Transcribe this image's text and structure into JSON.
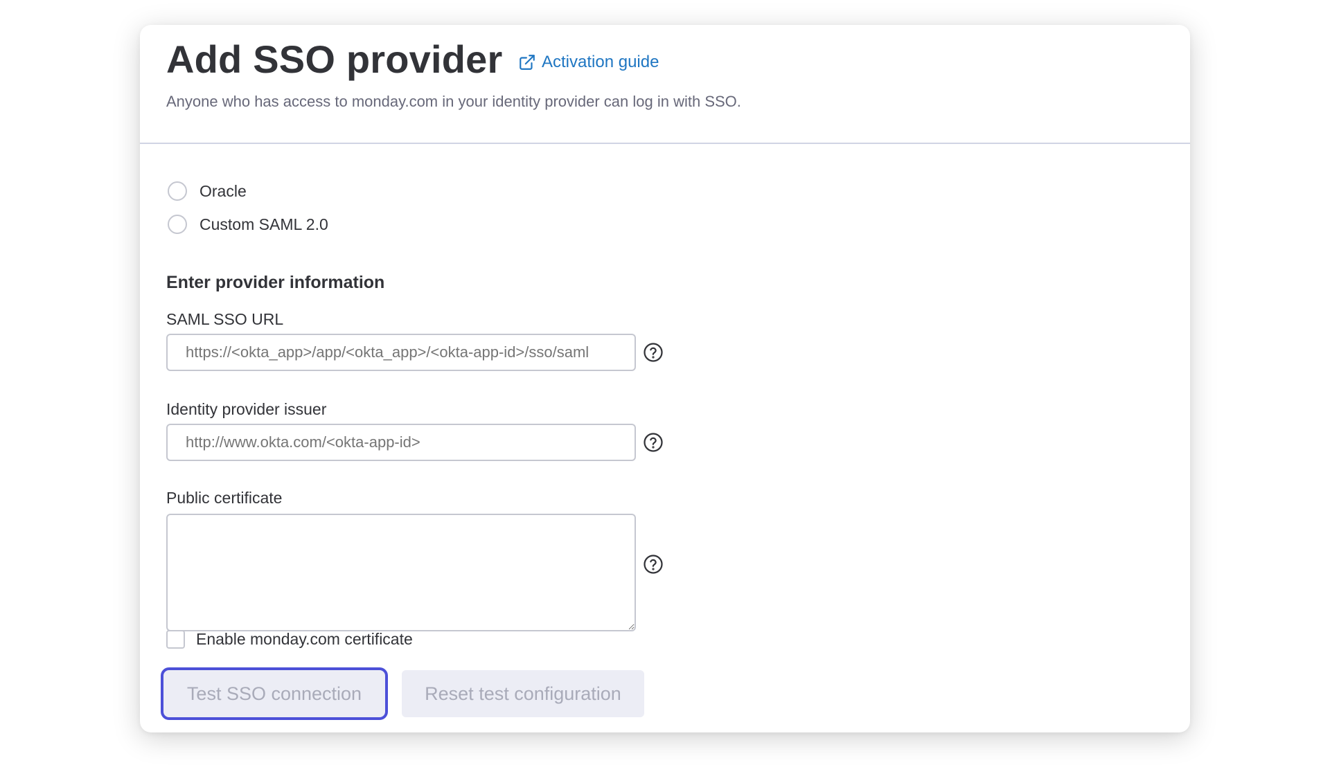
{
  "header": {
    "title": "Add SSO provider",
    "guide_link": "Activation guide",
    "subtitle": "Anyone who has access to monday.com in your identity provider can log in with SSO."
  },
  "providers": [
    {
      "label": "Oracle",
      "selected": false
    },
    {
      "label": "Custom SAML 2.0",
      "selected": false
    }
  ],
  "form": {
    "section_title": "Enter provider information",
    "saml_url": {
      "label": "SAML SSO URL",
      "placeholder": "https://<okta_app>/app/<okta_app>/<okta-app-id>/sso/saml"
    },
    "issuer": {
      "label": "Identity provider issuer",
      "placeholder": "http://www.okta.com/<okta-app-id>"
    },
    "certificate": {
      "label": "Public certificate",
      "value": ""
    },
    "enable_cert_label": "Enable monday.com certificate",
    "enable_cert_checked": false
  },
  "buttons": {
    "test": "Test SSO connection",
    "reset": "Reset test configuration"
  },
  "colors": {
    "link": "#1f76c2",
    "focus_ring": "#4c50d8",
    "disabled_bg": "#ecedf5",
    "disabled_text": "#a9abb9"
  },
  "icons": {
    "guide": "external-link-icon",
    "help": "help-circle-icon"
  }
}
